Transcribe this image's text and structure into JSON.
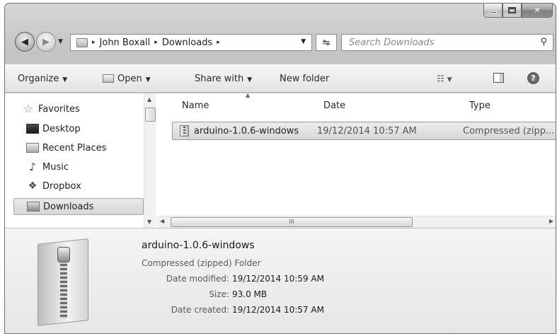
{
  "window": {
    "caption": {
      "minimize_icon": "minimize-icon",
      "maximize_icon": "maximize-icon",
      "close_glyph": "✕"
    }
  },
  "address": {
    "breadcrumbs": [
      "John Boxall",
      "Downloads"
    ],
    "separator": "▸",
    "search_placeholder": "Search Downloads"
  },
  "toolbar": {
    "organize": "Organize",
    "open": "Open",
    "share_with": "Share with",
    "new_folder": "New folder"
  },
  "nav_pane": {
    "items": [
      {
        "label": "Favorites",
        "icon": "star-icon"
      },
      {
        "label": "Desktop",
        "icon": "desktop-icon"
      },
      {
        "label": "Recent Places",
        "icon": "recent-places-icon"
      },
      {
        "label": "Music",
        "icon": "music-icon"
      },
      {
        "label": "Dropbox",
        "icon": "dropbox-icon"
      },
      {
        "label": "Downloads",
        "icon": "downloads-icon",
        "selected": true
      }
    ]
  },
  "file_list": {
    "columns": [
      "Name",
      "Date",
      "Type"
    ],
    "rows": [
      {
        "name": "arduino-1.0.6-windows",
        "date": "19/12/2014 10:57 AM",
        "type": "Compressed (zipp..."
      }
    ],
    "hscroll_grip": "III"
  },
  "details": {
    "title": "arduino-1.0.6-windows",
    "type": "Compressed (zipped) Folder",
    "fields": [
      {
        "key": "Date modified:",
        "value": "19/12/2014 10:59 AM"
      },
      {
        "key": "Size:",
        "value": "93.0 MB"
      },
      {
        "key": "Date created:",
        "value": "19/12/2014 10:57 AM"
      }
    ]
  }
}
